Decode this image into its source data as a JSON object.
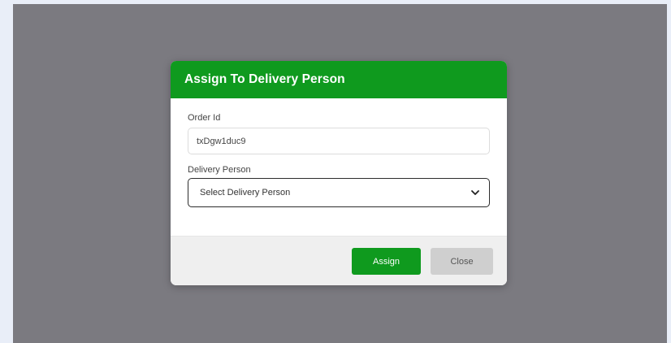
{
  "modal": {
    "title": "Assign To Delivery Person",
    "order_id_label": "Order Id",
    "order_id_value": "txDgw1duc9",
    "delivery_person_label": "Delivery Person",
    "required_marker": "*",
    "delivery_person_select": "Select Delivery Person",
    "assign_label": "Assign",
    "close_label": "Close"
  },
  "colors": {
    "header": "#0f9a1e",
    "assign_button": "#0f9a1e",
    "close_button": "#cfcfcf",
    "overlay": "#7b7a80",
    "required": "#e02424"
  },
  "icons": {
    "select_arrow": "chevron-down-icon"
  }
}
